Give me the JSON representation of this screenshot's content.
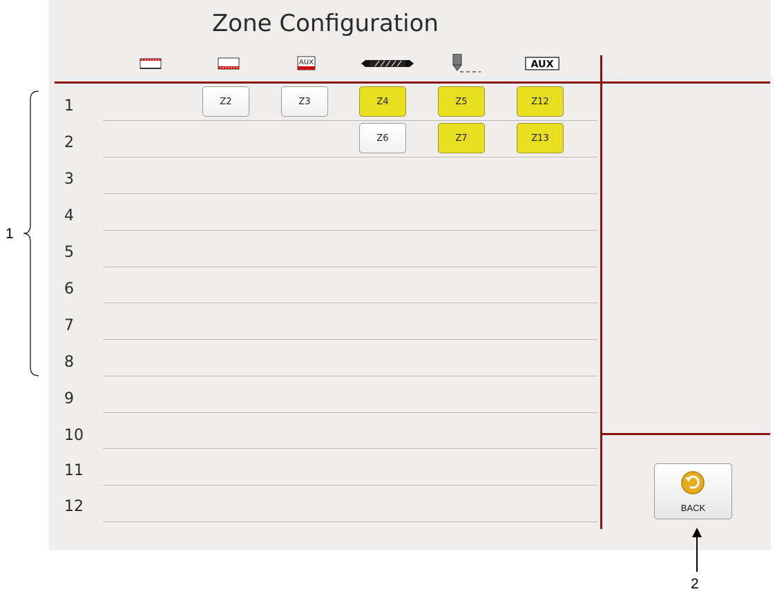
{
  "title": "Zone Configuration",
  "columns": [
    {
      "icon": "top-heater-icon"
    },
    {
      "icon": "bottom-heater-icon"
    },
    {
      "icon": "aux-heater-icon",
      "text": "AUX"
    },
    {
      "icon": "manifold-icon"
    },
    {
      "icon": "nozzle-icon"
    },
    {
      "icon": "aux-box-icon",
      "text": "AUX"
    }
  ],
  "rows": [
    "1",
    "2",
    "3",
    "4",
    "5",
    "6",
    "7",
    "8",
    "9",
    "10",
    "11",
    "12"
  ],
  "zones": [
    {
      "label": "Z2",
      "state": "white"
    },
    {
      "label": "Z3",
      "state": "white"
    },
    {
      "label": "Z4",
      "state": "yellow"
    },
    {
      "label": "Z5",
      "state": "yellow"
    },
    {
      "label": "Z12",
      "state": "yellow"
    },
    {
      "label": "Z6",
      "state": "white"
    },
    {
      "label": "Z7",
      "state": "yellow"
    },
    {
      "label": "Z13",
      "state": "yellow"
    }
  ],
  "back_button": {
    "label": "BACK"
  },
  "callouts": {
    "rows_label": "1",
    "back_label": "2"
  },
  "colors": {
    "accent": "#8b1010",
    "active_zone": "#e8df20"
  }
}
